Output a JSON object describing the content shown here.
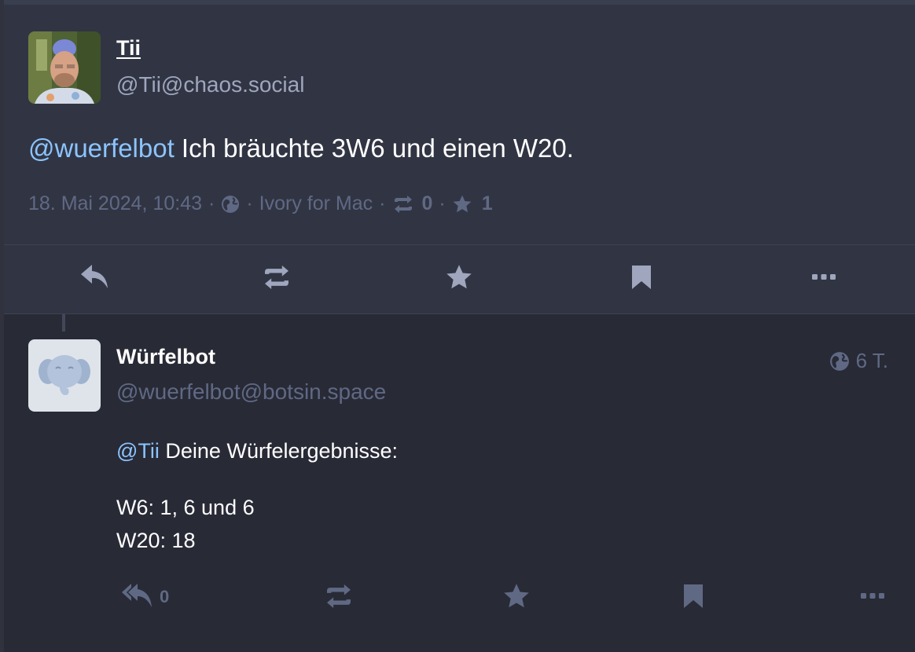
{
  "main_post": {
    "display_name": "Tii",
    "acct": "@Tii@chaos.social",
    "mention": "@wuerfelbot",
    "text": " Ich bräuchte 3W6 und einen W20.",
    "date": "18. Mai 2024, 10:43",
    "application": "Ivory for Mac",
    "boost_count": "0",
    "favourite_count": "1",
    "separator": "·"
  },
  "reply_post": {
    "display_name": "Würfelbot",
    "acct": "@wuerfelbot@botsin.space",
    "relative_time": "6 T.",
    "mention": "@Tii",
    "line1": " Deine Würfelergebnisse:",
    "line2": "W6: 1, 6 und 6",
    "line3": "W20: 18",
    "reply_count": "0"
  },
  "icons": {
    "reply": "reply-icon",
    "reply_all": "reply-all-icon",
    "boost": "retweet-icon",
    "favourite": "star-icon",
    "bookmark": "bookmark-icon",
    "more": "ellipsis-icon",
    "visibility": "globe-icon"
  },
  "colors": {
    "background": "#282a36",
    "focused_background": "#313543",
    "mention": "#8cc4ff",
    "muted": "#606984",
    "icon": "#9fa6bd"
  }
}
